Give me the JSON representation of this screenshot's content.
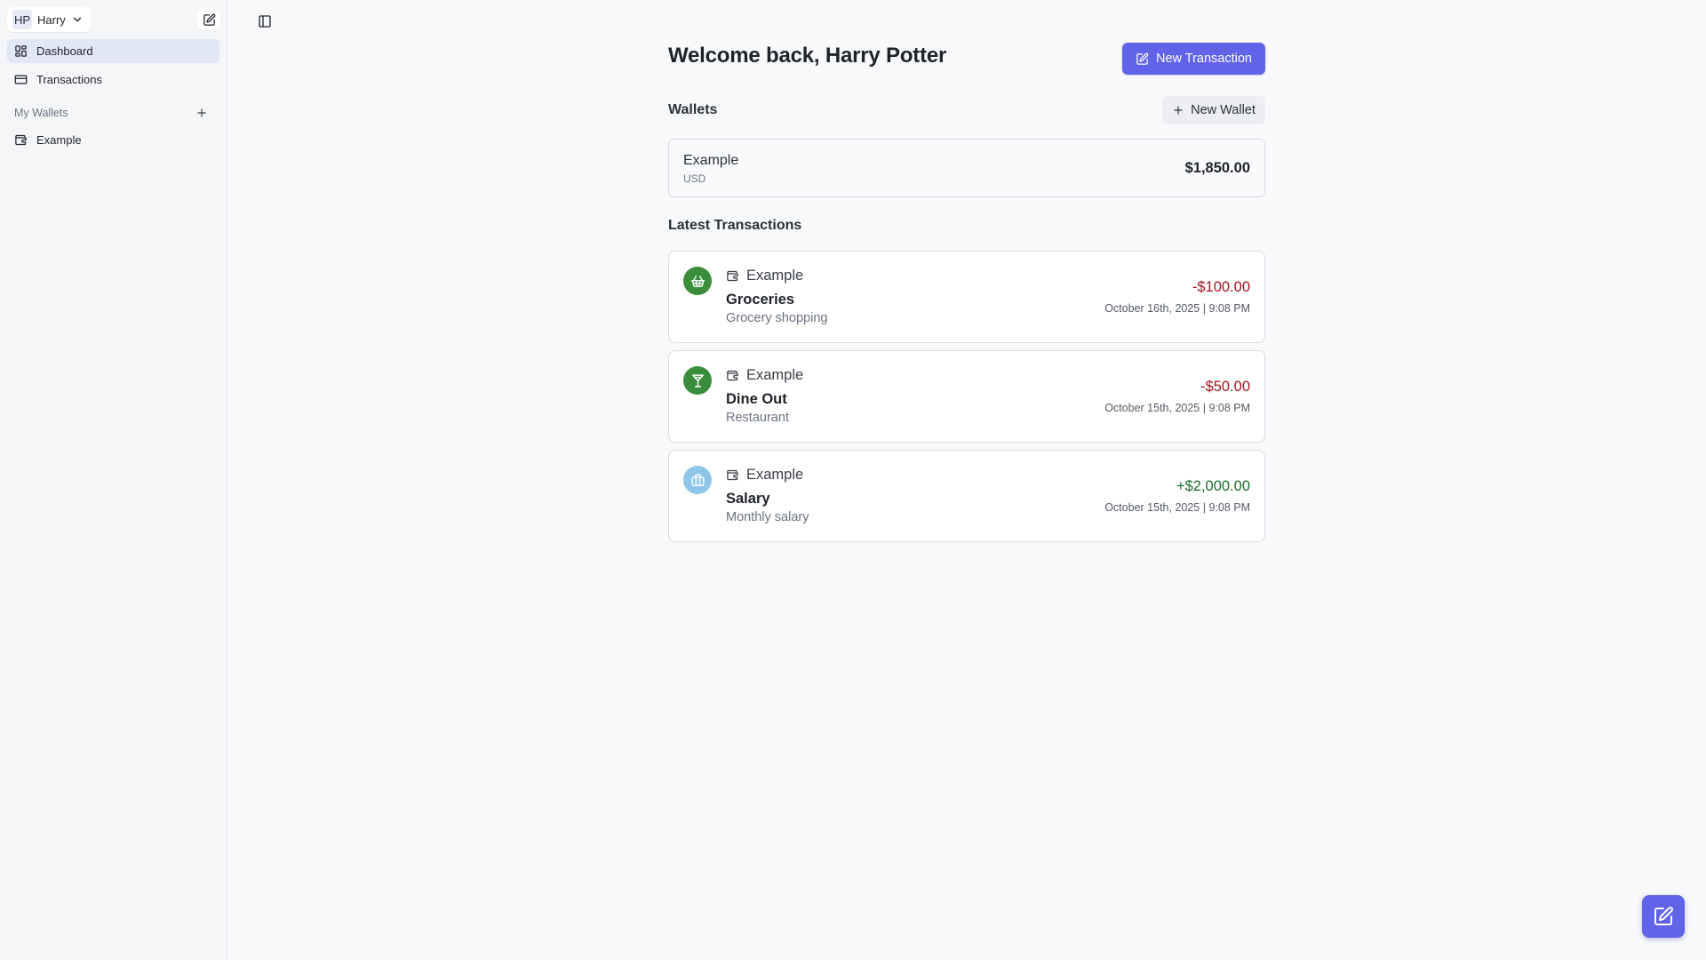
{
  "user": {
    "initials": "HP",
    "name": "Harry"
  },
  "sidebar": {
    "nav": [
      {
        "label": "Dashboard",
        "icon": "dashboard-icon",
        "active": true
      },
      {
        "label": "Transactions",
        "icon": "credit-card-icon",
        "active": false
      }
    ],
    "wallets_section_label": "My Wallets",
    "wallets": [
      {
        "label": "Example",
        "icon": "wallet-icon"
      }
    ]
  },
  "main": {
    "welcome": "Welcome back, Harry Potter",
    "new_transaction_label": "New Transaction",
    "wallets_heading": "Wallets",
    "new_wallet_label": "New Wallet",
    "wallet_card": {
      "name": "Example",
      "currency": "USD",
      "balance": "$1,850.00"
    },
    "latest_heading": "Latest Transactions",
    "transactions": [
      {
        "wallet": "Example",
        "category": "Groceries",
        "description": "Grocery shopping",
        "amount": "-$100.00",
        "date": "October 16th, 2025 | 9:08 PM",
        "icon": "shopping-basket-icon",
        "icon_color": "#3a8d3a",
        "amount_type": "negative"
      },
      {
        "wallet": "Example",
        "category": "Dine Out",
        "description": "Restaurant",
        "amount": "-$50.00",
        "date": "October 15th, 2025 | 9:08 PM",
        "icon": "cocktail-glass-icon",
        "icon_color": "#3a8d3a",
        "amount_type": "negative"
      },
      {
        "wallet": "Example",
        "category": "Salary",
        "description": "Monthly salary",
        "amount": "+$2,000.00",
        "date": "October 15th, 2025 | 9:08 PM",
        "icon": "briefcase-icon",
        "icon_color": "#8ec5e8",
        "amount_type": "positive"
      }
    ]
  },
  "colors": {
    "accent": "#6163e8",
    "negative": "#a3151c",
    "positive": "#1a6b2c",
    "sidebar_active": "#e2e7f6"
  }
}
